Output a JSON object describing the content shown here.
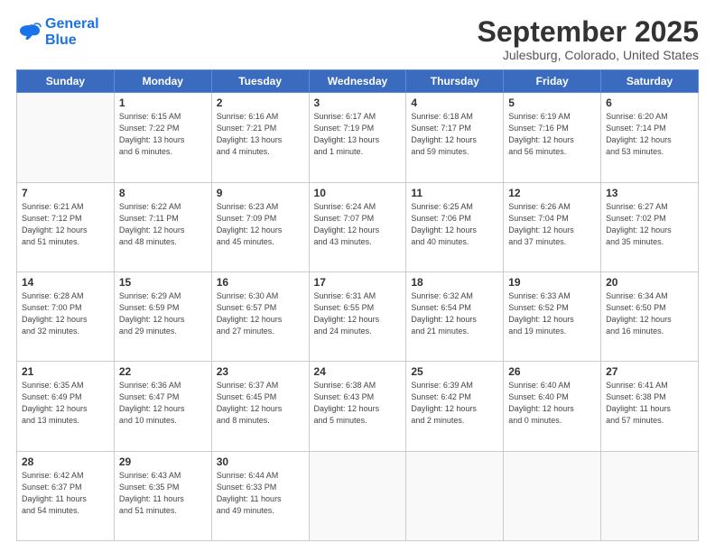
{
  "logo": {
    "line1": "General",
    "line2": "Blue"
  },
  "title": "September 2025",
  "location": "Julesburg, Colorado, United States",
  "days_of_week": [
    "Sunday",
    "Monday",
    "Tuesday",
    "Wednesday",
    "Thursday",
    "Friday",
    "Saturday"
  ],
  "weeks": [
    [
      {
        "num": "",
        "info": ""
      },
      {
        "num": "1",
        "info": "Sunrise: 6:15 AM\nSunset: 7:22 PM\nDaylight: 13 hours\nand 6 minutes."
      },
      {
        "num": "2",
        "info": "Sunrise: 6:16 AM\nSunset: 7:21 PM\nDaylight: 13 hours\nand 4 minutes."
      },
      {
        "num": "3",
        "info": "Sunrise: 6:17 AM\nSunset: 7:19 PM\nDaylight: 13 hours\nand 1 minute."
      },
      {
        "num": "4",
        "info": "Sunrise: 6:18 AM\nSunset: 7:17 PM\nDaylight: 12 hours\nand 59 minutes."
      },
      {
        "num": "5",
        "info": "Sunrise: 6:19 AM\nSunset: 7:16 PM\nDaylight: 12 hours\nand 56 minutes."
      },
      {
        "num": "6",
        "info": "Sunrise: 6:20 AM\nSunset: 7:14 PM\nDaylight: 12 hours\nand 53 minutes."
      }
    ],
    [
      {
        "num": "7",
        "info": "Sunrise: 6:21 AM\nSunset: 7:12 PM\nDaylight: 12 hours\nand 51 minutes."
      },
      {
        "num": "8",
        "info": "Sunrise: 6:22 AM\nSunset: 7:11 PM\nDaylight: 12 hours\nand 48 minutes."
      },
      {
        "num": "9",
        "info": "Sunrise: 6:23 AM\nSunset: 7:09 PM\nDaylight: 12 hours\nand 45 minutes."
      },
      {
        "num": "10",
        "info": "Sunrise: 6:24 AM\nSunset: 7:07 PM\nDaylight: 12 hours\nand 43 minutes."
      },
      {
        "num": "11",
        "info": "Sunrise: 6:25 AM\nSunset: 7:06 PM\nDaylight: 12 hours\nand 40 minutes."
      },
      {
        "num": "12",
        "info": "Sunrise: 6:26 AM\nSunset: 7:04 PM\nDaylight: 12 hours\nand 37 minutes."
      },
      {
        "num": "13",
        "info": "Sunrise: 6:27 AM\nSunset: 7:02 PM\nDaylight: 12 hours\nand 35 minutes."
      }
    ],
    [
      {
        "num": "14",
        "info": "Sunrise: 6:28 AM\nSunset: 7:00 PM\nDaylight: 12 hours\nand 32 minutes."
      },
      {
        "num": "15",
        "info": "Sunrise: 6:29 AM\nSunset: 6:59 PM\nDaylight: 12 hours\nand 29 minutes."
      },
      {
        "num": "16",
        "info": "Sunrise: 6:30 AM\nSunset: 6:57 PM\nDaylight: 12 hours\nand 27 minutes."
      },
      {
        "num": "17",
        "info": "Sunrise: 6:31 AM\nSunset: 6:55 PM\nDaylight: 12 hours\nand 24 minutes."
      },
      {
        "num": "18",
        "info": "Sunrise: 6:32 AM\nSunset: 6:54 PM\nDaylight: 12 hours\nand 21 minutes."
      },
      {
        "num": "19",
        "info": "Sunrise: 6:33 AM\nSunset: 6:52 PM\nDaylight: 12 hours\nand 19 minutes."
      },
      {
        "num": "20",
        "info": "Sunrise: 6:34 AM\nSunset: 6:50 PM\nDaylight: 12 hours\nand 16 minutes."
      }
    ],
    [
      {
        "num": "21",
        "info": "Sunrise: 6:35 AM\nSunset: 6:49 PM\nDaylight: 12 hours\nand 13 minutes."
      },
      {
        "num": "22",
        "info": "Sunrise: 6:36 AM\nSunset: 6:47 PM\nDaylight: 12 hours\nand 10 minutes."
      },
      {
        "num": "23",
        "info": "Sunrise: 6:37 AM\nSunset: 6:45 PM\nDaylight: 12 hours\nand 8 minutes."
      },
      {
        "num": "24",
        "info": "Sunrise: 6:38 AM\nSunset: 6:43 PM\nDaylight: 12 hours\nand 5 minutes."
      },
      {
        "num": "25",
        "info": "Sunrise: 6:39 AM\nSunset: 6:42 PM\nDaylight: 12 hours\nand 2 minutes."
      },
      {
        "num": "26",
        "info": "Sunrise: 6:40 AM\nSunset: 6:40 PM\nDaylight: 12 hours\nand 0 minutes."
      },
      {
        "num": "27",
        "info": "Sunrise: 6:41 AM\nSunset: 6:38 PM\nDaylight: 11 hours\nand 57 minutes."
      }
    ],
    [
      {
        "num": "28",
        "info": "Sunrise: 6:42 AM\nSunset: 6:37 PM\nDaylight: 11 hours\nand 54 minutes."
      },
      {
        "num": "29",
        "info": "Sunrise: 6:43 AM\nSunset: 6:35 PM\nDaylight: 11 hours\nand 51 minutes."
      },
      {
        "num": "30",
        "info": "Sunrise: 6:44 AM\nSunset: 6:33 PM\nDaylight: 11 hours\nand 49 minutes."
      },
      {
        "num": "",
        "info": ""
      },
      {
        "num": "",
        "info": ""
      },
      {
        "num": "",
        "info": ""
      },
      {
        "num": "",
        "info": ""
      }
    ]
  ]
}
